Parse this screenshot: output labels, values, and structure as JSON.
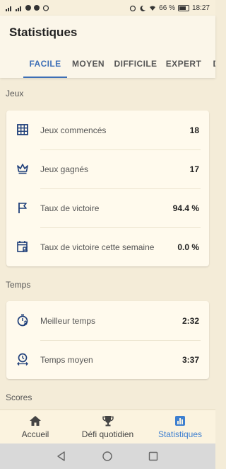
{
  "status_bar": {
    "battery": "66 %",
    "time": "18:27"
  },
  "header": {
    "title": "Statistiques"
  },
  "tabs": [
    {
      "label": "FACILE",
      "active": true
    },
    {
      "label": "MOYEN",
      "active": false
    },
    {
      "label": "DIFFICILE",
      "active": false
    },
    {
      "label": "EXPERT",
      "active": false
    }
  ],
  "sections": {
    "jeux": {
      "title": "Jeux",
      "rows": [
        {
          "icon": "grid-icon",
          "label": "Jeux commencés",
          "value": "18"
        },
        {
          "icon": "crown-icon",
          "label": "Jeux gagnés",
          "value": "17"
        },
        {
          "icon": "flag-icon",
          "label": "Taux de victoire",
          "value": "94.4 %"
        },
        {
          "icon": "calendar-flag-icon",
          "label": "Taux de victoire cette semaine",
          "value": "0.0 %"
        }
      ]
    },
    "temps": {
      "title": "Temps",
      "rows": [
        {
          "icon": "stopwatch-icon",
          "label": "Meilleur temps",
          "value": "2:32"
        },
        {
          "icon": "clock-arrows-icon",
          "label": "Temps moyen",
          "value": "3:37"
        }
      ]
    },
    "scores": {
      "title": "Scores"
    }
  },
  "bottom_nav": [
    {
      "icon": "home-icon",
      "label": "Accueil",
      "active": false
    },
    {
      "icon": "trophy-icon",
      "label": "Défi quotidien",
      "active": false
    },
    {
      "icon": "bar-chart-icon",
      "label": "Statistiques",
      "active": true
    }
  ],
  "colors": {
    "accent": "#3d6fb6",
    "icon_blue": "#1f3f7a",
    "background": "#f4ecd8",
    "card": "#fffaed"
  }
}
